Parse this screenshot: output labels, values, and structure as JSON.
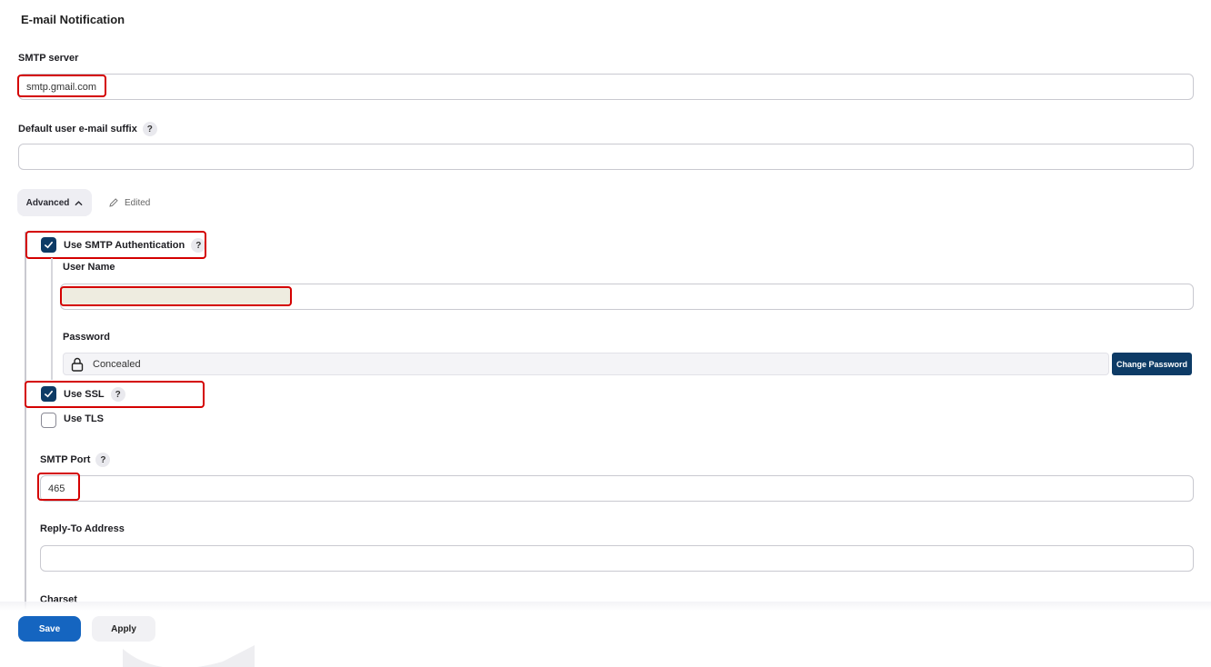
{
  "section": {
    "title": "E-mail Notification"
  },
  "smtp_server": {
    "label": "SMTP server",
    "value": "smtp.gmail.com"
  },
  "default_suffix": {
    "label": "Default user e-mail suffix",
    "help": "?",
    "value": ""
  },
  "advanced": {
    "label": "Advanced",
    "edited_label": "Edited"
  },
  "smtp_auth": {
    "label": "Use SMTP Authentication",
    "help": "?",
    "checked": true,
    "username_label": "User Name",
    "password_label": "Password",
    "password_value": "Concealed",
    "change_password_label": "Change Password"
  },
  "use_ssl": {
    "label": "Use SSL",
    "help": "?",
    "checked": true
  },
  "use_tls": {
    "label": "Use TLS",
    "checked": false
  },
  "smtp_port": {
    "label": "SMTP Port",
    "help": "?",
    "value": "465"
  },
  "reply_to": {
    "label": "Reply-To Address",
    "value": ""
  },
  "charset": {
    "label": "Charset"
  },
  "footer": {
    "save_label": "Save",
    "apply_label": "Apply"
  },
  "colors": {
    "primary": "#1565c0",
    "checkbox": "#0d3b66",
    "highlight": "#d40000"
  },
  "icons": {
    "chevron": "chevron-up-icon",
    "edit": "pencil-icon",
    "lock": "lock-icon",
    "check": "check-icon"
  }
}
